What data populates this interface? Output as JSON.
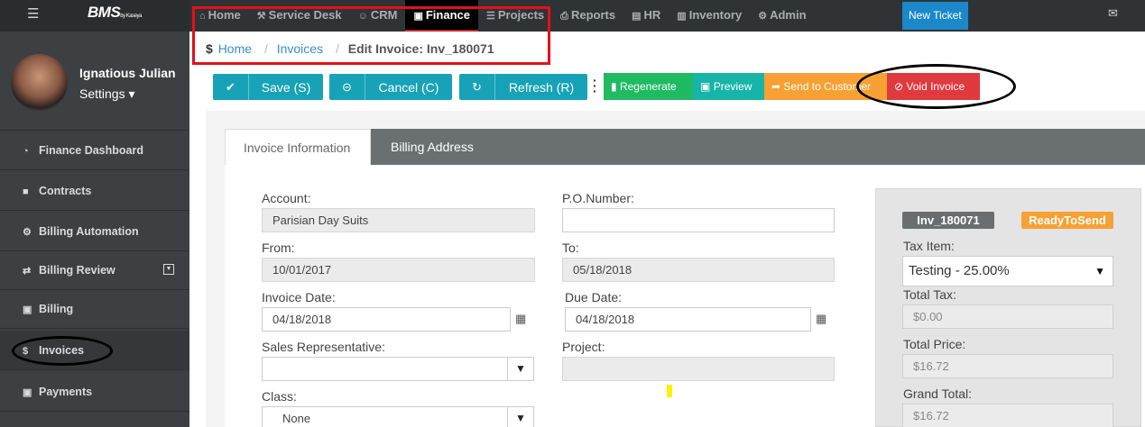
{
  "header": {
    "brand": "BMS",
    "brand_sub": "by Kaseya",
    "nav": [
      {
        "label": "Home",
        "icon": "home-icon",
        "glyph": "⌂"
      },
      {
        "label": "Service Desk",
        "icon": "wrench-icon",
        "glyph": "⚒"
      },
      {
        "label": "CRM",
        "icon": "users-icon",
        "glyph": "☺"
      },
      {
        "label": "Finance",
        "icon": "money-icon",
        "glyph": "▣"
      },
      {
        "label": "Projects",
        "icon": "list-icon",
        "glyph": "☰"
      },
      {
        "label": "Reports",
        "icon": "print-icon",
        "glyph": "⎙"
      },
      {
        "label": "HR",
        "icon": "briefcase-icon",
        "glyph": "▤"
      },
      {
        "label": "Inventory",
        "icon": "building-icon",
        "glyph": "▥"
      },
      {
        "label": "Admin",
        "icon": "gear-icon",
        "glyph": "⚙"
      }
    ],
    "new_ticket": "New Ticket"
  },
  "user": {
    "name": "Ignatious Julian",
    "settings": "Settings ▾"
  },
  "sidebar": {
    "items": [
      {
        "label": "Finance Dashboard",
        "icon": "dashboard-icon",
        "glyph": "◔"
      },
      {
        "label": "Contracts",
        "icon": "book-icon",
        "glyph": "■"
      },
      {
        "label": "Billing Automation",
        "icon": "cogs-icon",
        "glyph": "⚙"
      },
      {
        "label": "Billing Review",
        "icon": "retweet-icon",
        "glyph": "⇄"
      },
      {
        "label": "Billing",
        "icon": "money-icon",
        "glyph": "▣"
      },
      {
        "label": "Invoices",
        "icon": "dollar-icon",
        "glyph": "$"
      },
      {
        "label": "Payments",
        "icon": "money-icon",
        "glyph": "▣"
      }
    ]
  },
  "breadcrumb": {
    "sep": "/",
    "home": "Home",
    "invoices": "Invoices",
    "current": "Edit Invoice: Inv_180071",
    "currency": "$"
  },
  "toolbar": {
    "save": "Save (S)",
    "cancel": "Cancel (C)",
    "refresh": "Refresh (R)",
    "regenerate": "Regenerate",
    "preview": "Preview",
    "send": "Send to Customer",
    "void": "Void Invoice"
  },
  "tabs": {
    "info": "Invoice Information",
    "billing": "Billing Address"
  },
  "form": {
    "account_label": "Account:",
    "account_value": "Parisian Day Suits",
    "po_label": "P.O.Number:",
    "po_value": "",
    "from_label": "From:",
    "from_value": "10/01/2017",
    "to_label": "To:",
    "to_value": "05/18/2018",
    "invoice_date_label": "Invoice Date:",
    "invoice_date_value": "04/18/2018",
    "due_date_label": "Due Date:",
    "due_date_value": "04/18/2018",
    "sales_rep_label": "Sales Representative:",
    "sales_rep_value": "",
    "project_label": "Project:",
    "project_value": "",
    "class_label": "Class:",
    "class_value": "None"
  },
  "summary": {
    "invoice_id": "Inv_180071",
    "status": "ReadyToSend",
    "tax_item_label": "Tax Item:",
    "tax_item_value": "Testing - 25.00%",
    "total_tax_label": "Total Tax:",
    "total_tax_value": "$0.00",
    "total_price_label": "Total Price:",
    "total_price_value": "$16.72",
    "grand_total_label": "Grand Total:",
    "grand_total_value": "$16.72"
  },
  "colors": {
    "teal": "#17a2b8",
    "green": "#1fba62",
    "orange": "#f7a134",
    "red": "#e0393e",
    "nav_bg": "#2f3335",
    "sidebar_bg": "#3c4042"
  }
}
